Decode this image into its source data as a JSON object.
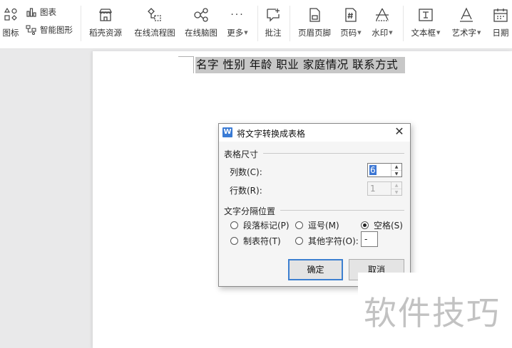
{
  "ribbon": {
    "shapes_label": "图标",
    "chart_label": "图表",
    "smart_art_label": "智能图形",
    "items": [
      {
        "label": "稻壳资源",
        "icon": "shop-icon"
      },
      {
        "label": "在线流程图",
        "icon": "flowchart-icon"
      },
      {
        "label": "在线脑图",
        "icon": "mindmap-icon"
      },
      {
        "label": "更多",
        "icon": "more-icon"
      },
      {
        "label": "批注",
        "icon": "comment-icon"
      },
      {
        "label": "页眉页脚",
        "icon": "header-footer-icon"
      },
      {
        "label": "页码",
        "icon": "page-number-icon"
      },
      {
        "label": "水印",
        "icon": "watermark-icon"
      },
      {
        "label": "文本框",
        "icon": "textbox-icon"
      },
      {
        "label": "艺术字",
        "icon": "wordart-icon"
      },
      {
        "label": "日期",
        "icon": "calendar-icon"
      }
    ]
  },
  "document": {
    "selected_text": "名字 性别 年龄 职业 家庭情况 联系方式"
  },
  "dialog": {
    "title": "将文字转换成表格",
    "size_group": "表格尺寸",
    "columns_label": "列数(C):",
    "columns_value": "6",
    "rows_label": "行数(R):",
    "rows_value": "1",
    "separator_group": "文字分隔位置",
    "options": {
      "paragraph": "段落标记(P)",
      "comma": "逗号(M)",
      "space": "空格(S)",
      "tab": "制表符(T)",
      "other": "其他字符(O):"
    },
    "selected_option": "space",
    "other_char_value": "-",
    "ok_label": "确定",
    "cancel_label": "取消"
  },
  "watermark": "软件技巧",
  "colors": {
    "accent": "#3c7fd0",
    "selection": "#c7c7c7"
  }
}
